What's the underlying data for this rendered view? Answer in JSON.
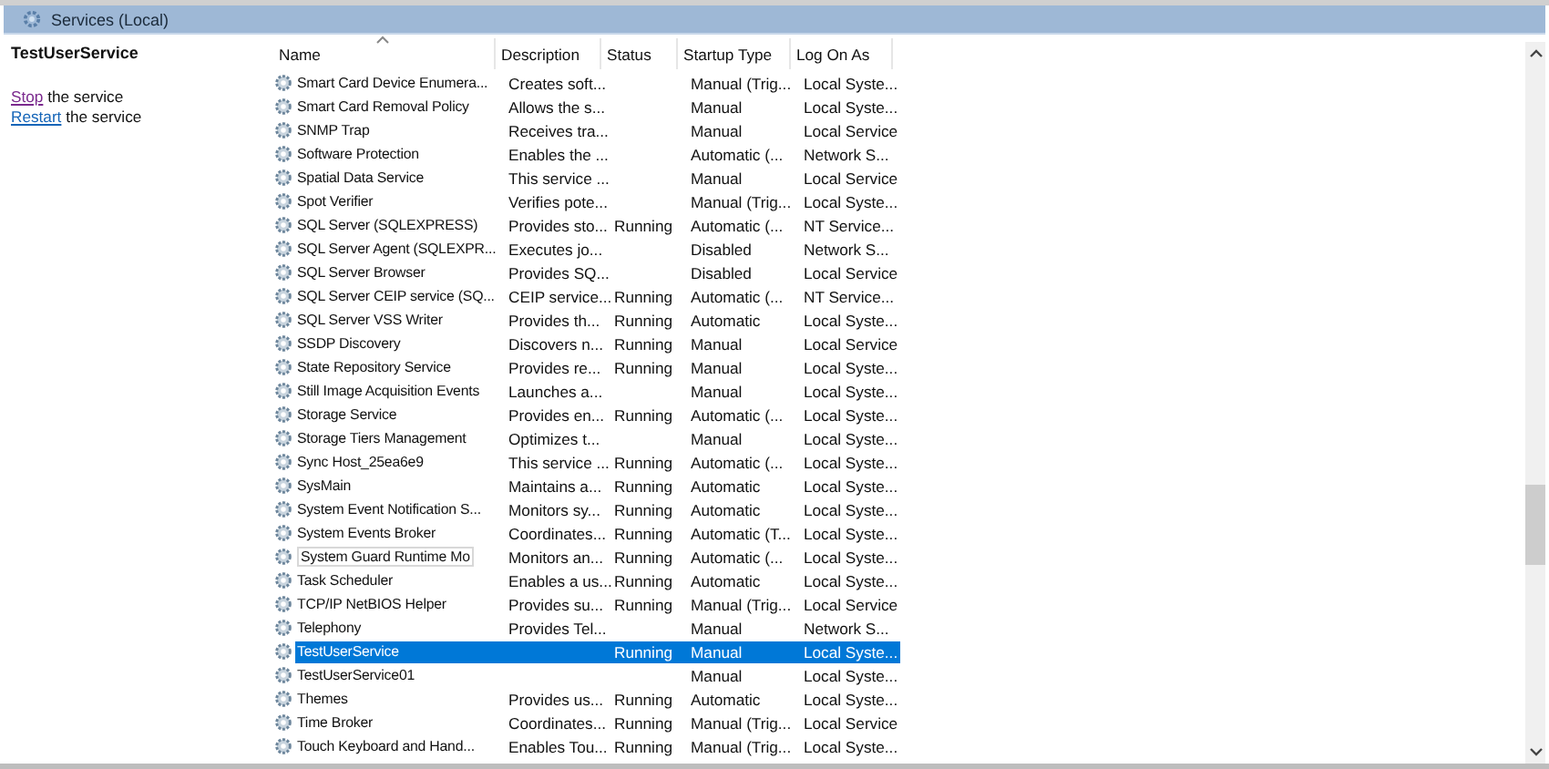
{
  "header": {
    "title": "Services (Local)"
  },
  "left_pane": {
    "service_name": "TestUserService",
    "actions": [
      {
        "link": "Stop",
        "text": " the service"
      },
      {
        "link": "Restart",
        "text": " the service"
      }
    ]
  },
  "table": {
    "columns": [
      "Name",
      "Description",
      "Status",
      "Startup Type",
      "Log On As"
    ],
    "rows": [
      {
        "cells": [
          "Smart Card Device Enumera...",
          "Creates soft...",
          "",
          "Manual (Trig...",
          "Local Syste..."
        ],
        "selected": false
      },
      {
        "cells": [
          "Smart Card Removal Policy",
          "Allows the s...",
          "",
          "Manual",
          "Local Syste..."
        ],
        "selected": false
      },
      {
        "cells": [
          "SNMP Trap",
          "Receives tra...",
          "",
          "Manual",
          "Local Service"
        ],
        "selected": false
      },
      {
        "cells": [
          "Software Protection",
          "Enables the ...",
          "",
          "Automatic (...",
          "Network S..."
        ],
        "selected": false
      },
      {
        "cells": [
          "Spatial Data Service",
          "This service ...",
          "",
          "Manual",
          "Local Service"
        ],
        "selected": false
      },
      {
        "cells": [
          "Spot Verifier",
          "Verifies pote...",
          "",
          "Manual (Trig...",
          "Local Syste..."
        ],
        "selected": false
      },
      {
        "cells": [
          "SQL Server (SQLEXPRESS)",
          "Provides sto...",
          "Running",
          "Automatic (...",
          "NT Service..."
        ],
        "selected": false
      },
      {
        "cells": [
          "SQL Server Agent (SQLEXPR...",
          "Executes jo...",
          "",
          "Disabled",
          "Network S..."
        ],
        "selected": false
      },
      {
        "cells": [
          "SQL Server Browser",
          "Provides SQ...",
          "",
          "Disabled",
          "Local Service"
        ],
        "selected": false
      },
      {
        "cells": [
          "SQL Server CEIP service (SQ...",
          "CEIP service...",
          "Running",
          "Automatic (...",
          "NT Service..."
        ],
        "selected": false
      },
      {
        "cells": [
          "SQL Server VSS Writer",
          "Provides th...",
          "Running",
          "Automatic",
          "Local Syste..."
        ],
        "selected": false
      },
      {
        "cells": [
          "SSDP Discovery",
          "Discovers n...",
          "Running",
          "Manual",
          "Local Service"
        ],
        "selected": false
      },
      {
        "cells": [
          "State Repository Service",
          "Provides re...",
          "Running",
          "Manual",
          "Local Syste..."
        ],
        "selected": false
      },
      {
        "cells": [
          "Still Image Acquisition Events",
          "Launches a...",
          "",
          "Manual",
          "Local Syste..."
        ],
        "selected": false
      },
      {
        "cells": [
          "Storage Service",
          "Provides en...",
          "Running",
          "Automatic (...",
          "Local Syste..."
        ],
        "selected": false
      },
      {
        "cells": [
          "Storage Tiers Management",
          "Optimizes t...",
          "",
          "Manual",
          "Local Syste..."
        ],
        "selected": false
      },
      {
        "cells": [
          "Sync Host_25ea6e9",
          "This service ...",
          "Running",
          "Automatic (...",
          "Local Syste..."
        ],
        "selected": false
      },
      {
        "cells": [
          "SysMain",
          "Maintains a...",
          "Running",
          "Automatic",
          "Local Syste..."
        ],
        "selected": false
      },
      {
        "cells": [
          "System Event Notification S...",
          "Monitors sy...",
          "Running",
          "Automatic",
          "Local Syste..."
        ],
        "selected": false
      },
      {
        "cells": [
          "System Events Broker",
          "Coordinates...",
          "Running",
          "Automatic (T...",
          "Local Syste..."
        ],
        "selected": false
      },
      {
        "cells": [
          "System Guard Runtime Mo",
          "Monitors an...",
          "Running",
          "Automatic (...",
          "Local Syste..."
        ],
        "selected": false
      },
      {
        "cells": [
          "Task Scheduler",
          "Enables a us...",
          "Running",
          "Automatic",
          "Local Syste..."
        ],
        "selected": false
      },
      {
        "cells": [
          "TCP/IP NetBIOS Helper",
          "Provides su...",
          "Running",
          "Manual (Trig...",
          "Local Service"
        ],
        "selected": false
      },
      {
        "cells": [
          "Telephony",
          "Provides Tel...",
          "",
          "Manual",
          "Network S..."
        ],
        "selected": false
      },
      {
        "cells": [
          "TestUserService",
          "",
          "Running",
          "Manual",
          "Local Syste..."
        ],
        "selected": true
      },
      {
        "cells": [
          "TestUserService01",
          "",
          "",
          "Manual",
          "Local Syste..."
        ],
        "selected": false
      },
      {
        "cells": [
          "Themes",
          "Provides us...",
          "Running",
          "Automatic",
          "Local Syste..."
        ],
        "selected": false
      },
      {
        "cells": [
          "Time Broker",
          "Coordinates...",
          "Running",
          "Manual (Trig...",
          "Local Service"
        ],
        "selected": false
      },
      {
        "cells": [
          "Touch Keyboard and Hand...",
          "Enables Tou...",
          "Running",
          "Manual (Trig...",
          "Local Syste..."
        ],
        "selected": false
      }
    ]
  }
}
